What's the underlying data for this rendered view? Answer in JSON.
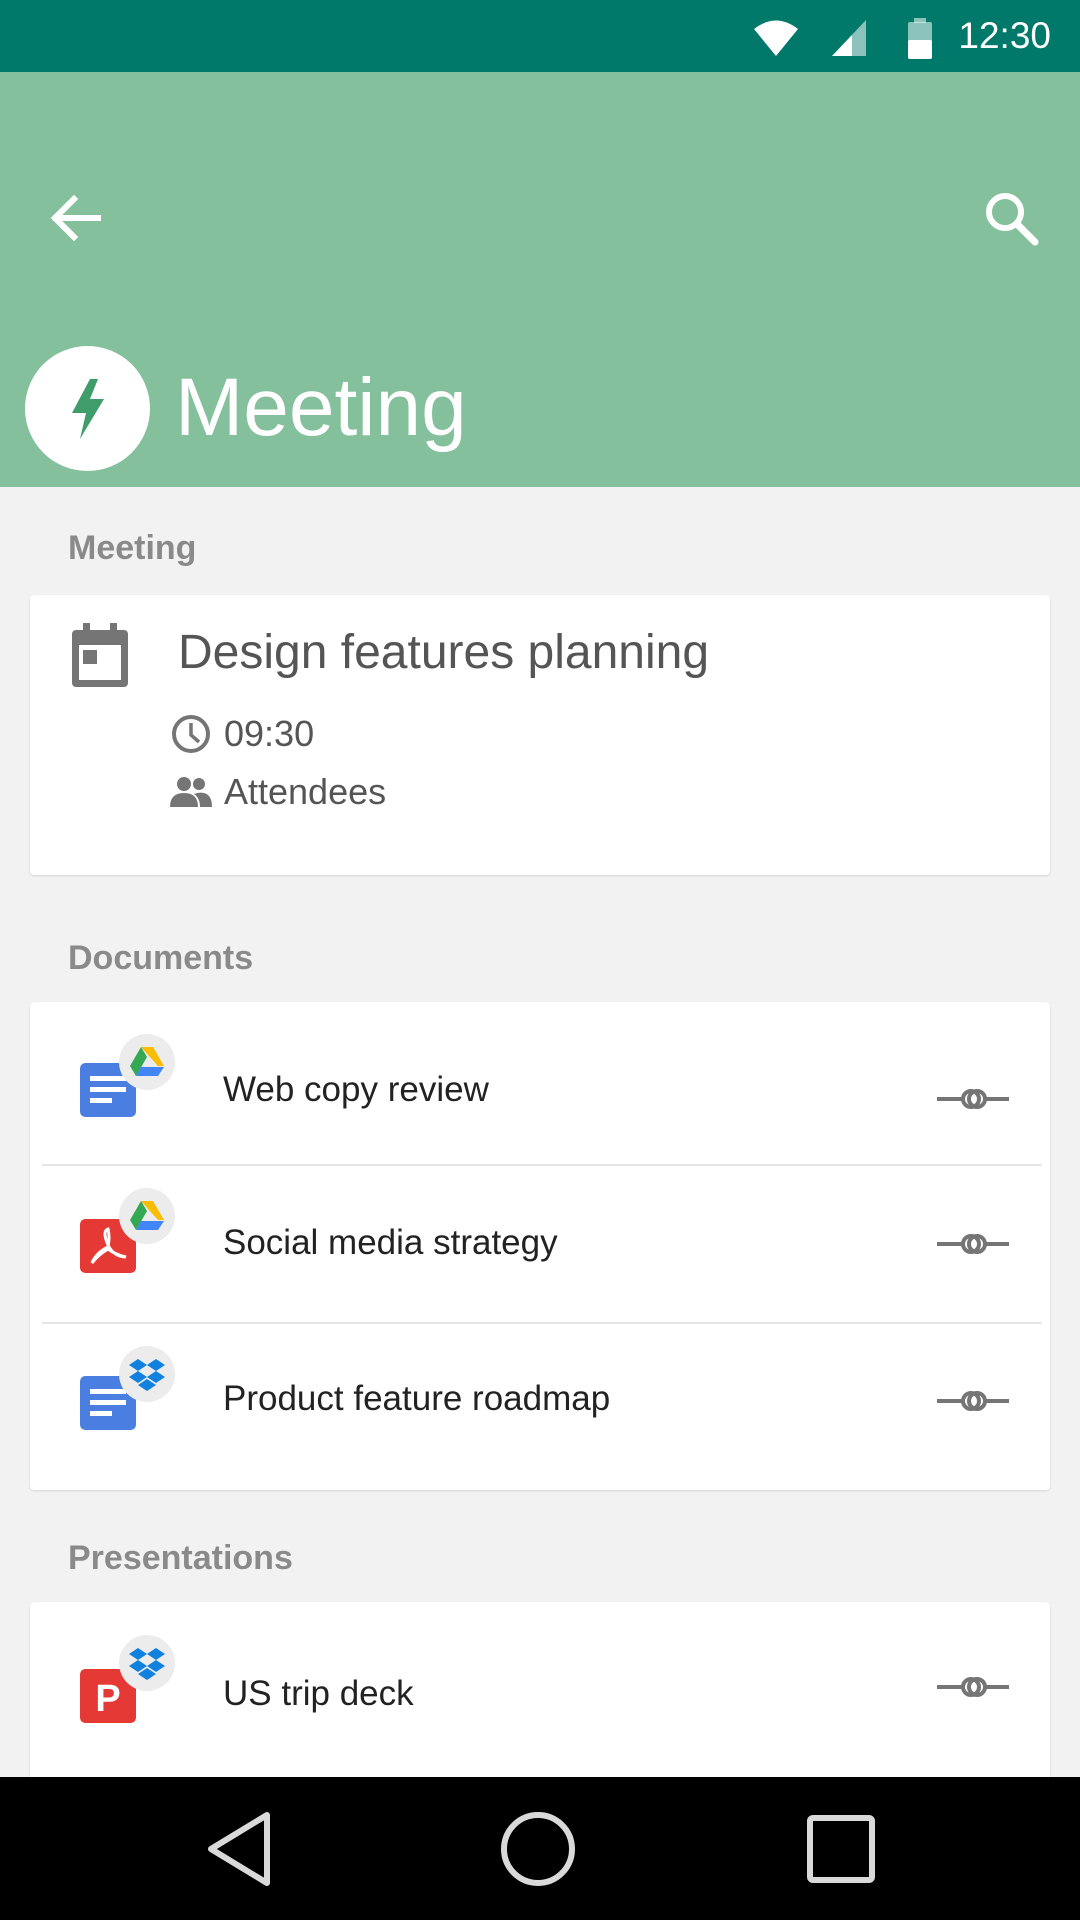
{
  "status_bar": {
    "time": "12:30",
    "icons": [
      "wifi-icon",
      "cell-signal-icon",
      "battery-icon"
    ]
  },
  "app_bar": {
    "title": "Meeting",
    "back_icon": "arrow-back-icon",
    "search_icon": "search-icon",
    "avatar_icon": "bolt-icon",
    "color": "#85c09c"
  },
  "meeting_section": {
    "label": "Meeting",
    "event": {
      "title": "Design features planning",
      "time": "09:30",
      "attendees_label": "Attendees"
    }
  },
  "documents_section": {
    "label": "Documents",
    "items": [
      {
        "name": "Web copy review",
        "file_icon": "google-doc-icon",
        "source_icon": "google-drive-icon"
      },
      {
        "name": "Social media strategy",
        "file_icon": "pdf-icon",
        "source_icon": "google-drive-icon"
      },
      {
        "name": "Product feature roadmap",
        "file_icon": "google-doc-icon",
        "source_icon": "dropbox-icon"
      }
    ]
  },
  "presentations_section": {
    "label": "Presentations",
    "items": [
      {
        "name": "US trip deck",
        "file_icon": "presentation-icon",
        "source_icon": "dropbox-icon"
      }
    ]
  },
  "nav_bar": {
    "buttons": [
      "back-triangle-icon",
      "home-circle-icon",
      "recents-square-icon"
    ]
  }
}
